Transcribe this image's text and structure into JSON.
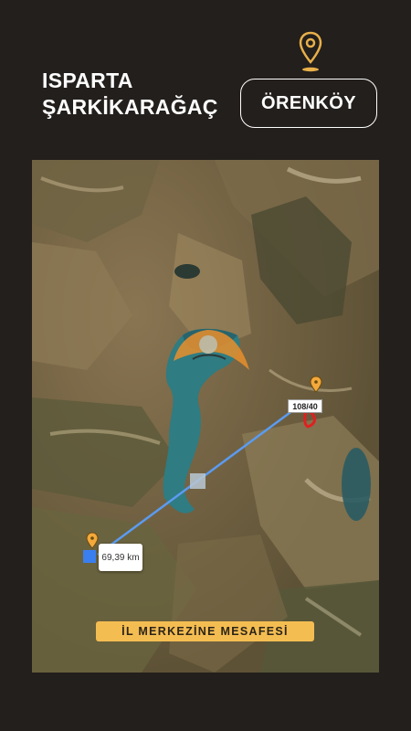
{
  "header": {
    "title_line1": "ISPARTA",
    "title_line2": "ŞARKİKARAĞAÇ",
    "location_button": "ÖRENKÖY",
    "pin_icon": "location-pin-icon"
  },
  "map": {
    "type": "satellite",
    "distance_label": "69,39 km",
    "parcel_label": "108/40",
    "banner": "İL MERKEZİNE  MESAFESİ",
    "colors": {
      "pin": "#f3a93b",
      "route_line": "#5b9bf0",
      "parcel_outline": "#e02020",
      "lake": "#2f7c82",
      "banner": "#f4bd52"
    }
  }
}
